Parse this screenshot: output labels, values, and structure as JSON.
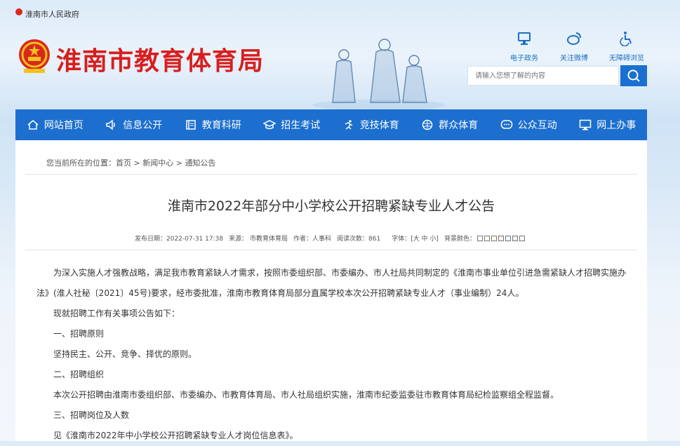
{
  "topbar": {
    "gov_link": "淮南市人民政府"
  },
  "header": {
    "site_title": "淮南市教育体育局",
    "quick_links": [
      {
        "label": "电子政务",
        "icon": "monitor-icon"
      },
      {
        "label": "关注微博",
        "icon": "weibo-icon"
      },
      {
        "label": "无障碍浏览",
        "icon": "accessibility-icon"
      }
    ],
    "search": {
      "placeholder": "请输入您想了解的内容",
      "icon": "search-icon"
    }
  },
  "nav": [
    {
      "label": "网站首页",
      "icon": "home-icon"
    },
    {
      "label": "信息公开",
      "icon": "speaker-icon"
    },
    {
      "label": "教育科研",
      "icon": "book-icon"
    },
    {
      "label": "招生考试",
      "icon": "graduation-cap-icon"
    },
    {
      "label": "竞技体育",
      "icon": "runner-icon"
    },
    {
      "label": "群众体育",
      "icon": "ball-icon"
    },
    {
      "label": "公众互动",
      "icon": "chat-icon"
    },
    {
      "label": "网上办事",
      "icon": "monitor-icon"
    }
  ],
  "breadcrumb": {
    "prefix": "您当前所在的位置：",
    "items": [
      "首页",
      "新闻中心",
      "通知公告"
    ],
    "separator": " > "
  },
  "article": {
    "title": "淮南市2022年部分中小学校公开招聘紧缺专业人才公告",
    "meta": {
      "date": "发布日期：2022-07-31 17:38",
      "source": "来源：  市教育体育局",
      "author": "作者：人事科",
      "views": "阅读次数：861",
      "font_size": "字体：[大 中 小]",
      "bg_label": "背景颜色：",
      "bg_colors": [
        "#ffffff",
        "#fafff4",
        "#fffff0",
        "#fff2f2",
        "#eaf6ff",
        "#f1f1f1",
        "#ffffff"
      ]
    },
    "paragraphs": [
      {
        "type": "indent",
        "text": "为深入实施人才强教战略，满足我市教育紧缺人才需求，按照市委组织部、市委编办、市人社局共同制定的《淮南市事业单位引进急需紧缺人才招聘实施办法》(淮人社秘〔2021〕45号)要求，经市委批准，淮南市教育体育局部分直属学校本次公开招聘紧缺专业人才（事业编制）24人。"
      },
      {
        "type": "indent",
        "text": "现就招聘工作有关事项公告如下："
      },
      {
        "type": "section",
        "text": "一、招聘原则"
      },
      {
        "type": "section",
        "text": "坚持民主、公开、竞争、择优的原则。"
      },
      {
        "type": "section",
        "text": "二、招聘组织"
      },
      {
        "type": "section",
        "text": "本次公开招聘由淮南市委组织部、市委编办、市教育体育局、市人社局组织实施，淮南市纪委监委驻市教育体育局纪检监察组全程监督。"
      },
      {
        "type": "section",
        "text": "三、招聘岗位及人数"
      },
      {
        "type": "section",
        "text": "见《淮南市2022年中小学校公开招聘紧缺专业人才岗位信息表》。"
      }
    ]
  },
  "colors": {
    "brand_red": "#d81e1e",
    "nav_blue": "#1c6fce",
    "link_blue": "#1e6fc4"
  }
}
